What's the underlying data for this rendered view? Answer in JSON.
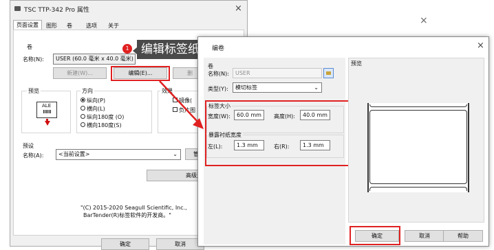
{
  "back_window": {
    "title": "TSC TTP-342 Pro 属性",
    "close_glyph": "×",
    "tabs": [
      "页面设置",
      "图形",
      "卷",
      "选项",
      "关于"
    ],
    "roll_group": "卷",
    "name_label": "名称(N):",
    "name_value": "USER (60.0 毫米 x 40.0 毫米)",
    "new_button": "新建(W)...",
    "edit_button": "编辑(E)...",
    "delete_button": "删",
    "preview_group": "预览",
    "preview_icon_text": "ALE",
    "orientation_group": "方向",
    "orientations": [
      "纵向(P)",
      "横向(L)",
      "纵向180度 (O)",
      "横向180度(S)"
    ],
    "orientation_selected": 0,
    "effects_group": "效果",
    "effects": [
      "镜像(",
      "负片图"
    ],
    "preset_group": "预设",
    "preset_name_label": "名称(A):",
    "preset_value": "<当前设置>",
    "manage_button": "管理",
    "advanced_button": "高级选项",
    "copyright": [
      "\"(C) 2015-2020 Seagull Scientific, Inc.,",
      "BarTender(R)标签软件的开发商。\""
    ],
    "ok_button": "确定",
    "cancel_button": "取消"
  },
  "right_bg_close": "×",
  "callout": {
    "badge": "1",
    "text": "编辑标签纸"
  },
  "front_window": {
    "title": "编卷",
    "close_glyph": "×",
    "roll_label": "卷",
    "name_label": "名称(N):",
    "name_value": "USER",
    "type_label": "类型(Y):",
    "type_value": "模切标签",
    "label_size_group": "标签大小",
    "width_label": "宽度(W):",
    "width_value": "60.0 mm",
    "height_label": "高度(H):",
    "height_value": "40.0 mm",
    "liner_group": "暴露衬纸宽度",
    "left_label": "左(L):",
    "left_value": "1.3 mm",
    "right_label": "右(R):",
    "right_value": "1.3 mm",
    "preview_label": "预览",
    "ok_button": "确定",
    "cancel_button": "取消",
    "help_button": "帮助"
  },
  "colors": {
    "highlight": "#e02020",
    "callout_bg": "#4a4a4a",
    "badge": "#e02020"
  }
}
